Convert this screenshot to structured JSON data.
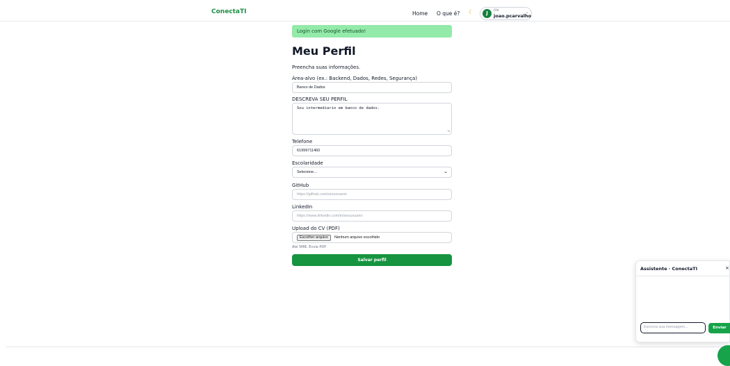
{
  "navbar": {
    "brand": "ConectaTI",
    "links": [
      "Home",
      "O que é?"
    ],
    "theme_icon": "moon-icon",
    "user": {
      "initial": "J",
      "greeting": "Olá",
      "username": "joao.pcarvalho"
    }
  },
  "alert": "Login com Google efetuado!",
  "page": {
    "title": "Meu Perfil",
    "intro": "Preencha suas informações."
  },
  "form": {
    "area_label": "Área-alvo (ex.: Backend, Dados, Redes, Segurança)",
    "area_value": "Banco de Dados",
    "profile_label": "DESCREVA SEU PERFIL",
    "profile_value": "Sou intermediario em banco de dados.",
    "phone_label": "Telefone",
    "phone_value": "61999711460",
    "education_label": "Escolaridade",
    "education_value": "Selecione...",
    "github_label": "GitHub",
    "github_placeholder": "https://github.com/seuusuario",
    "linkedin_label": "LinkedIn",
    "linkedin_placeholder": "https://www.linkedin.com/in/seuusuario",
    "cv_label": "Upload do CV (PDF)",
    "cv_button": "Escolher arquivo",
    "cv_status": "Nenhum arquivo escolhido",
    "cv_hint": "Até 5MB. Envie PDF.",
    "save_button": "Salvar perfil"
  },
  "chat": {
    "title": "Assistente · ConectaTI",
    "close": "×",
    "input_placeholder": "Escreva sua mensagem...",
    "send_button": "Enviar"
  },
  "colors": {
    "brand": "#1e8f46",
    "alert_bg": "#93eaa9",
    "button": "#16943f"
  }
}
